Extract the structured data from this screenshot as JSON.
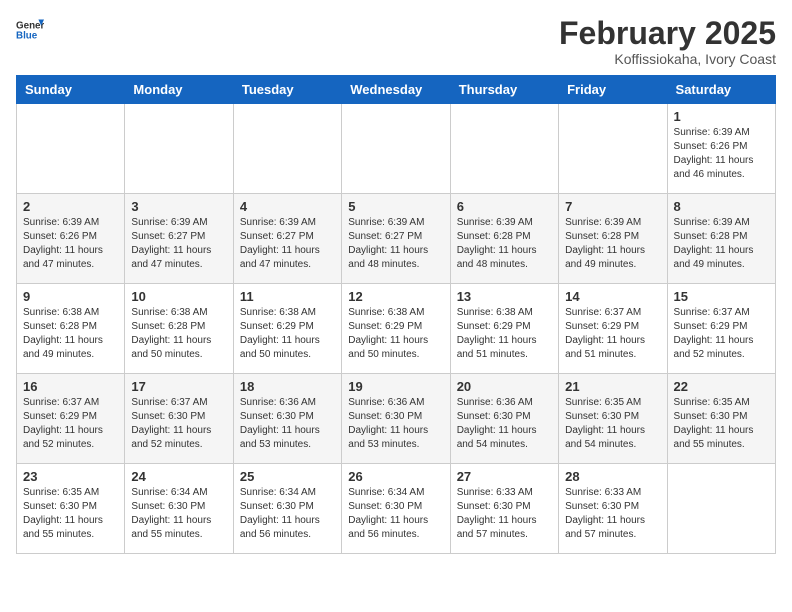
{
  "header": {
    "logo": {
      "general": "General",
      "blue": "Blue"
    },
    "month": "February 2025",
    "location": "Koffissiokaha, Ivory Coast"
  },
  "days_of_week": [
    "Sunday",
    "Monday",
    "Tuesday",
    "Wednesday",
    "Thursday",
    "Friday",
    "Saturday"
  ],
  "weeks": [
    [
      {
        "day": "",
        "info": ""
      },
      {
        "day": "",
        "info": ""
      },
      {
        "day": "",
        "info": ""
      },
      {
        "day": "",
        "info": ""
      },
      {
        "day": "",
        "info": ""
      },
      {
        "day": "",
        "info": ""
      },
      {
        "day": "1",
        "info": "Sunrise: 6:39 AM\nSunset: 6:26 PM\nDaylight: 11 hours\nand 46 minutes."
      }
    ],
    [
      {
        "day": "2",
        "info": "Sunrise: 6:39 AM\nSunset: 6:26 PM\nDaylight: 11 hours\nand 47 minutes."
      },
      {
        "day": "3",
        "info": "Sunrise: 6:39 AM\nSunset: 6:27 PM\nDaylight: 11 hours\nand 47 minutes."
      },
      {
        "day": "4",
        "info": "Sunrise: 6:39 AM\nSunset: 6:27 PM\nDaylight: 11 hours\nand 47 minutes."
      },
      {
        "day": "5",
        "info": "Sunrise: 6:39 AM\nSunset: 6:27 PM\nDaylight: 11 hours\nand 48 minutes."
      },
      {
        "day": "6",
        "info": "Sunrise: 6:39 AM\nSunset: 6:28 PM\nDaylight: 11 hours\nand 48 minutes."
      },
      {
        "day": "7",
        "info": "Sunrise: 6:39 AM\nSunset: 6:28 PM\nDaylight: 11 hours\nand 49 minutes."
      },
      {
        "day": "8",
        "info": "Sunrise: 6:39 AM\nSunset: 6:28 PM\nDaylight: 11 hours\nand 49 minutes."
      }
    ],
    [
      {
        "day": "9",
        "info": "Sunrise: 6:38 AM\nSunset: 6:28 PM\nDaylight: 11 hours\nand 49 minutes."
      },
      {
        "day": "10",
        "info": "Sunrise: 6:38 AM\nSunset: 6:28 PM\nDaylight: 11 hours\nand 50 minutes."
      },
      {
        "day": "11",
        "info": "Sunrise: 6:38 AM\nSunset: 6:29 PM\nDaylight: 11 hours\nand 50 minutes."
      },
      {
        "day": "12",
        "info": "Sunrise: 6:38 AM\nSunset: 6:29 PM\nDaylight: 11 hours\nand 50 minutes."
      },
      {
        "day": "13",
        "info": "Sunrise: 6:38 AM\nSunset: 6:29 PM\nDaylight: 11 hours\nand 51 minutes."
      },
      {
        "day": "14",
        "info": "Sunrise: 6:37 AM\nSunset: 6:29 PM\nDaylight: 11 hours\nand 51 minutes."
      },
      {
        "day": "15",
        "info": "Sunrise: 6:37 AM\nSunset: 6:29 PM\nDaylight: 11 hours\nand 52 minutes."
      }
    ],
    [
      {
        "day": "16",
        "info": "Sunrise: 6:37 AM\nSunset: 6:29 PM\nDaylight: 11 hours\nand 52 minutes."
      },
      {
        "day": "17",
        "info": "Sunrise: 6:37 AM\nSunset: 6:30 PM\nDaylight: 11 hours\nand 52 minutes."
      },
      {
        "day": "18",
        "info": "Sunrise: 6:36 AM\nSunset: 6:30 PM\nDaylight: 11 hours\nand 53 minutes."
      },
      {
        "day": "19",
        "info": "Sunrise: 6:36 AM\nSunset: 6:30 PM\nDaylight: 11 hours\nand 53 minutes."
      },
      {
        "day": "20",
        "info": "Sunrise: 6:36 AM\nSunset: 6:30 PM\nDaylight: 11 hours\nand 54 minutes."
      },
      {
        "day": "21",
        "info": "Sunrise: 6:35 AM\nSunset: 6:30 PM\nDaylight: 11 hours\nand 54 minutes."
      },
      {
        "day": "22",
        "info": "Sunrise: 6:35 AM\nSunset: 6:30 PM\nDaylight: 11 hours\nand 55 minutes."
      }
    ],
    [
      {
        "day": "23",
        "info": "Sunrise: 6:35 AM\nSunset: 6:30 PM\nDaylight: 11 hours\nand 55 minutes."
      },
      {
        "day": "24",
        "info": "Sunrise: 6:34 AM\nSunset: 6:30 PM\nDaylight: 11 hours\nand 55 minutes."
      },
      {
        "day": "25",
        "info": "Sunrise: 6:34 AM\nSunset: 6:30 PM\nDaylight: 11 hours\nand 56 minutes."
      },
      {
        "day": "26",
        "info": "Sunrise: 6:34 AM\nSunset: 6:30 PM\nDaylight: 11 hours\nand 56 minutes."
      },
      {
        "day": "27",
        "info": "Sunrise: 6:33 AM\nSunset: 6:30 PM\nDaylight: 11 hours\nand 57 minutes."
      },
      {
        "day": "28",
        "info": "Sunrise: 6:33 AM\nSunset: 6:30 PM\nDaylight: 11 hours\nand 57 minutes."
      },
      {
        "day": "",
        "info": ""
      }
    ]
  ]
}
